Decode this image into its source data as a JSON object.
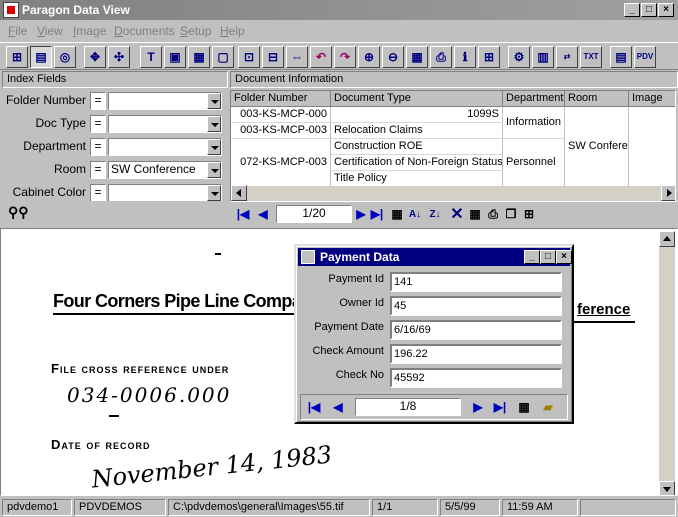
{
  "window": {
    "title": "Paragon Data View"
  },
  "menu": [
    {
      "u": "F",
      "rest": "ile"
    },
    {
      "u": "V",
      "rest": "iew"
    },
    {
      "u": "I",
      "rest": "mage"
    },
    {
      "u": "D",
      "rest": "ocuments"
    },
    {
      "u": "S",
      "rest": "etup"
    },
    {
      "u": "H",
      "rest": "elp"
    }
  ],
  "index_panel": {
    "header": "Index Fields",
    "fields": [
      {
        "label": "Folder Number",
        "op": "=",
        "value": ""
      },
      {
        "label": "Doc Type",
        "op": "=",
        "value": ""
      },
      {
        "label": "Department",
        "op": "=",
        "value": ""
      },
      {
        "label": "Room",
        "op": "=",
        "value": "SW Conference"
      },
      {
        "label": "Cabinet Color",
        "op": "=",
        "value": ""
      }
    ]
  },
  "doc_panel": {
    "header": "Document Information",
    "columns": [
      "Folder Number",
      "Document Type",
      "Department",
      "Room",
      "Image"
    ],
    "rows": {
      "folder": [
        "003-KS-MCP-000",
        "003-KS-MCP-003",
        "072-KS-MCP-003"
      ],
      "doctype": [
        "1099S",
        "Relocation Claims",
        "Construction ROE",
        "Certification of Non-Foreign Status",
        "Title Policy"
      ],
      "department": [
        "Information S",
        "Personnel"
      ],
      "room": [
        "SW Confere"
      ]
    },
    "nav_position": "1/20"
  },
  "document_image": {
    "company": "Four Corners Pipe Line Compar",
    "company_right": "ference",
    "label1": "File cross reference under",
    "handwritten_number": "034-0006.000",
    "label2": "Date of record",
    "handwritten_date": "November 14, 1983"
  },
  "payment_dialog": {
    "title": "Payment Data",
    "fields": [
      {
        "label": "Payment Id",
        "value": "141"
      },
      {
        "label": "Owner Id",
        "value": "45"
      },
      {
        "label": "Payment Date",
        "value": "6/16/69"
      },
      {
        "label": "Check Amount",
        "value": "196.22"
      },
      {
        "label": "Check No",
        "value": "45592"
      }
    ],
    "nav_position": "1/8"
  },
  "status": {
    "user": "pdvdemo1",
    "database": "PDVDEMOS",
    "path": "C:\\pdvdemos\\general\\Images\\55.tif",
    "page": "1/1",
    "date": "5/5/99",
    "time": "11:59 AM"
  }
}
